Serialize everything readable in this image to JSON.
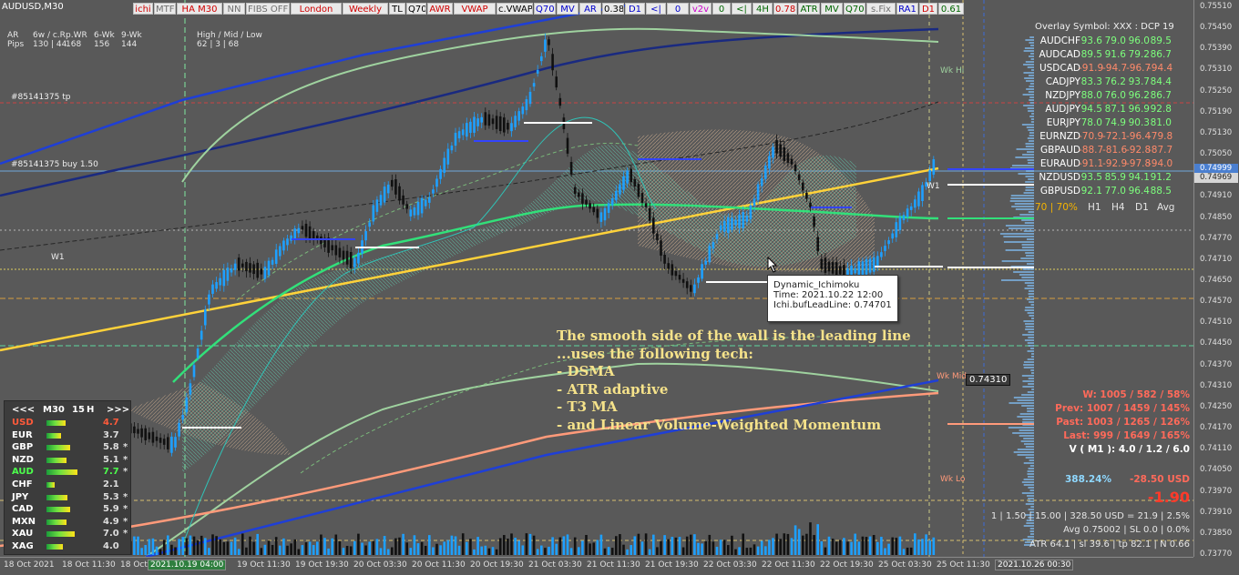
{
  "symbol_title": "AUDUSD,M30",
  "toolbar": [
    {
      "label": "ichi",
      "color": "#d00000"
    },
    {
      "label": "MTF",
      "color": "#707070"
    },
    {
      "label": "HA M30",
      "color": "#d00000"
    },
    {
      "label": "NN",
      "color": "#707070"
    },
    {
      "label": "FIBS OFF",
      "color": "#707070"
    },
    {
      "label": "London",
      "color": "#d00000"
    },
    {
      "label": "Weekly",
      "color": "#d00000"
    },
    {
      "label": "TL",
      "color": "#000000"
    },
    {
      "label": "Q70",
      "color": "#000000"
    },
    {
      "label": "AWR",
      "color": "#d00000"
    },
    {
      "label": "VWAP",
      "color": "#d00000"
    },
    {
      "label": "c.VWAP",
      "color": "#000000"
    },
    {
      "label": "Q70",
      "color": "#0000cc"
    },
    {
      "label": "MV",
      "color": "#0000cc"
    },
    {
      "label": "AR",
      "color": "#0000cc"
    },
    {
      "label": "0.38",
      "color": "#000000"
    },
    {
      "label": "D1",
      "color": "#0000cc"
    },
    {
      "label": "<|",
      "color": "#0000cc"
    },
    {
      "label": "0",
      "color": "#0000cc"
    },
    {
      "label": "v2v",
      "color": "#cc00cc"
    },
    {
      "label": "0",
      "color": "#006600"
    },
    {
      "label": "<|",
      "color": "#006600"
    },
    {
      "label": "4H",
      "color": "#006600"
    },
    {
      "label": "0.78",
      "color": "#d00000"
    },
    {
      "label": "ATR",
      "color": "#006600"
    },
    {
      "label": "MV",
      "color": "#006600"
    },
    {
      "label": "Q70",
      "color": "#006600"
    },
    {
      "label": "s.Fix",
      "color": "#707070"
    },
    {
      "label": "RA1",
      "color": "#0000cc"
    },
    {
      "label": "D1",
      "color": "#d00000"
    },
    {
      "label": "0.61",
      "color": "#006600"
    }
  ],
  "range_info": {
    "row1": [
      "AR",
      "6w / c.R",
      "p.WR",
      "6-Wk",
      "9-Wk",
      "High / Mid / Low"
    ],
    "row2": [
      "Pips",
      "130 | 44",
      "168",
      "156",
      "144",
      "62 | 3 | 68"
    ]
  },
  "labels": {
    "tp_order": "#85141375 tp",
    "buy_order": "#85141375 buy 1.50",
    "w1_left": "W1",
    "w1_right": "W1",
    "wk_hi": "Wk Hi",
    "wk_mid": "Wk Mid",
    "wk_lo": "Wk Lo",
    "price_box": "0.74310"
  },
  "price_axis": [
    "0.75510",
    "0.75450",
    "0.75390",
    "0.75310",
    "0.75250",
    "0.75190",
    "0.75130",
    "0.75050",
    "0.74990",
    "0.74910",
    "0.74850",
    "0.74770",
    "0.74710",
    "0.74650",
    "0.74570",
    "0.74510",
    "0.74450",
    "0.74370",
    "0.74310",
    "0.74250",
    "0.74170",
    "0.74110",
    "0.74050",
    "0.73970",
    "0.73910",
    "0.73850",
    "0.73770"
  ],
  "price_highlights": {
    "bid": "0.74969",
    "ask": "0.74999"
  },
  "time_axis": [
    "18 Oct 2021",
    "18 Oct 11:30",
    "18 Oct 19:30",
    "2021.10.19 04:00",
    "19 Oct 11:30",
    "19 Oct 19:30",
    "20 Oct 03:30",
    "20 Oct 11:30",
    "20 Oct 19:30",
    "21 Oct 03:30",
    "21 Oct 11:30",
    "21 Oct 19:30",
    "22 Oct 03:30",
    "22 Oct 11:30",
    "22 Oct 19:30",
    "25 Oct 03:30",
    "25 Oct 11:30",
    "2021.10.26 00:30"
  ],
  "overlay": {
    "title": "Overlay Symbol: XXX : DCP 19",
    "rows": [
      {
        "sym": "AUDCHF",
        "vals": [
          "93.6",
          "79.0",
          "96.0",
          "89.5"
        ],
        "color": "#7dff7d"
      },
      {
        "sym": "AUDCAD",
        "vals": [
          "89.5",
          "91.6",
          "79.2",
          "86.7"
        ],
        "color": "#7dff7d"
      },
      {
        "sym": "USDCAD",
        "vals": [
          "-91.9",
          "-94.7",
          "-96.7",
          "-94.4"
        ],
        "color": "#ff8a6a"
      },
      {
        "sym": "CADJPY",
        "vals": [
          "83.3",
          "76.2",
          "93.7",
          "84.4"
        ],
        "color": "#7dff7d"
      },
      {
        "sym": "NZDJPY",
        "vals": [
          "88.0",
          "76.0",
          "96.2",
          "86.7"
        ],
        "color": "#7dff7d"
      },
      {
        "sym": "AUDJPY",
        "vals": [
          "94.5",
          "87.1",
          "96.9",
          "92.8"
        ],
        "color": "#7dff7d"
      },
      {
        "sym": "EURJPY",
        "vals": [
          "78.0",
          "74.9",
          "90.3",
          "81.0"
        ],
        "color": "#7dff7d"
      },
      {
        "sym": "EURNZD",
        "vals": [
          "-70.9",
          "-72.1",
          "-96.4",
          "-79.8"
        ],
        "color": "#ff8a6a"
      },
      {
        "sym": "GBPAUD",
        "vals": [
          "-88.7",
          "-81.6",
          "-92.8",
          "-87.7"
        ],
        "color": "#ff8a6a"
      },
      {
        "sym": "EURAUD",
        "vals": [
          "-91.1",
          "-92.9",
          "-97.8",
          "-94.0"
        ],
        "color": "#ff8a6a"
      },
      {
        "sym": "NZDUSD",
        "vals": [
          "93.5",
          "85.9",
          "94.1",
          "91.2"
        ],
        "color": "#7dff7d"
      },
      {
        "sym": "GBPUSD",
        "vals": [
          "92.1",
          "77.0",
          "96.4",
          "88.5"
        ],
        "color": "#7dff7d"
      }
    ],
    "footer": [
      "70 | 70%",
      "H1",
      "H4",
      "D1",
      "Avg"
    ]
  },
  "strength": {
    "header": [
      "<<<",
      "M30",
      "15",
      "H",
      ">>>"
    ],
    "rows": [
      {
        "cur": "USD",
        "val": "4.7",
        "color": "#ff5a3a",
        "star": "",
        "bar": 0.52
      },
      {
        "cur": "EUR",
        "val": "3.7",
        "color": "#ffffff",
        "star": "",
        "bar": 0.4
      },
      {
        "cur": "GBP",
        "val": "5.8",
        "color": "#ffffff",
        "star": "*",
        "bar": 0.64
      },
      {
        "cur": "NZD",
        "val": "5.1",
        "color": "#ffffff",
        "star": "*",
        "bar": 0.56
      },
      {
        "cur": "AUD",
        "val": "7.7",
        "color": "#4cff4c",
        "star": "*",
        "bar": 0.86
      },
      {
        "cur": "CHF",
        "val": "2.1",
        "color": "#ffffff",
        "star": "",
        "bar": 0.22
      },
      {
        "cur": "JPY",
        "val": "5.3",
        "color": "#ffffff",
        "star": "*",
        "bar": 0.58
      },
      {
        "cur": "CAD",
        "val": "5.9",
        "color": "#ffffff",
        "star": "*",
        "bar": 0.65
      },
      {
        "cur": "MXN",
        "val": "4.9",
        "color": "#ffffff",
        "star": "*",
        "bar": 0.54
      },
      {
        "cur": "XAU",
        "val": "7.0",
        "color": "#ffffff",
        "star": "*",
        "bar": 0.77
      },
      {
        "cur": "XAG",
        "val": "4.0",
        "color": "#ffffff",
        "star": "",
        "bar": 0.44
      }
    ]
  },
  "tooltip": {
    "line1": "Dynamic_Ichimoku",
    "line2": "Time: 2021.10.22 12:00",
    "line3": "Ichi.bufLeadLine: 0.74701"
  },
  "annotation": {
    "lines": [
      "The smooth side of the wall is the leading line",
      "...uses the following tech:",
      "- DSMA",
      "- ATR adaptive",
      "- T3 MA",
      "- and Linear Volume-Weighted Momentum"
    ]
  },
  "stats": {
    "w": "W: 1005 / 582 / 58%",
    "prev": "Prev: 1007 / 1459 / 145%",
    "past": "Past: 1003 / 1265 / 126%",
    "last": "Last: 999 / 1649 / 165%",
    "v": "V ( M1 ): 4.0 / 1.2 / 6.0",
    "pct": "388.24%",
    "usd": "-28.50 USD",
    "big": "-1.90",
    "lot": "1  |  1.50  |  15.00  |  328.50 USD = 21.9  |  2.5%",
    "avg": "Avg 0.75002  |  SL 0.0  |  0.0%",
    "atr": "ATR 64.1  |  sl 39.6  |  tp 82.1  |  N 0.66"
  }
}
